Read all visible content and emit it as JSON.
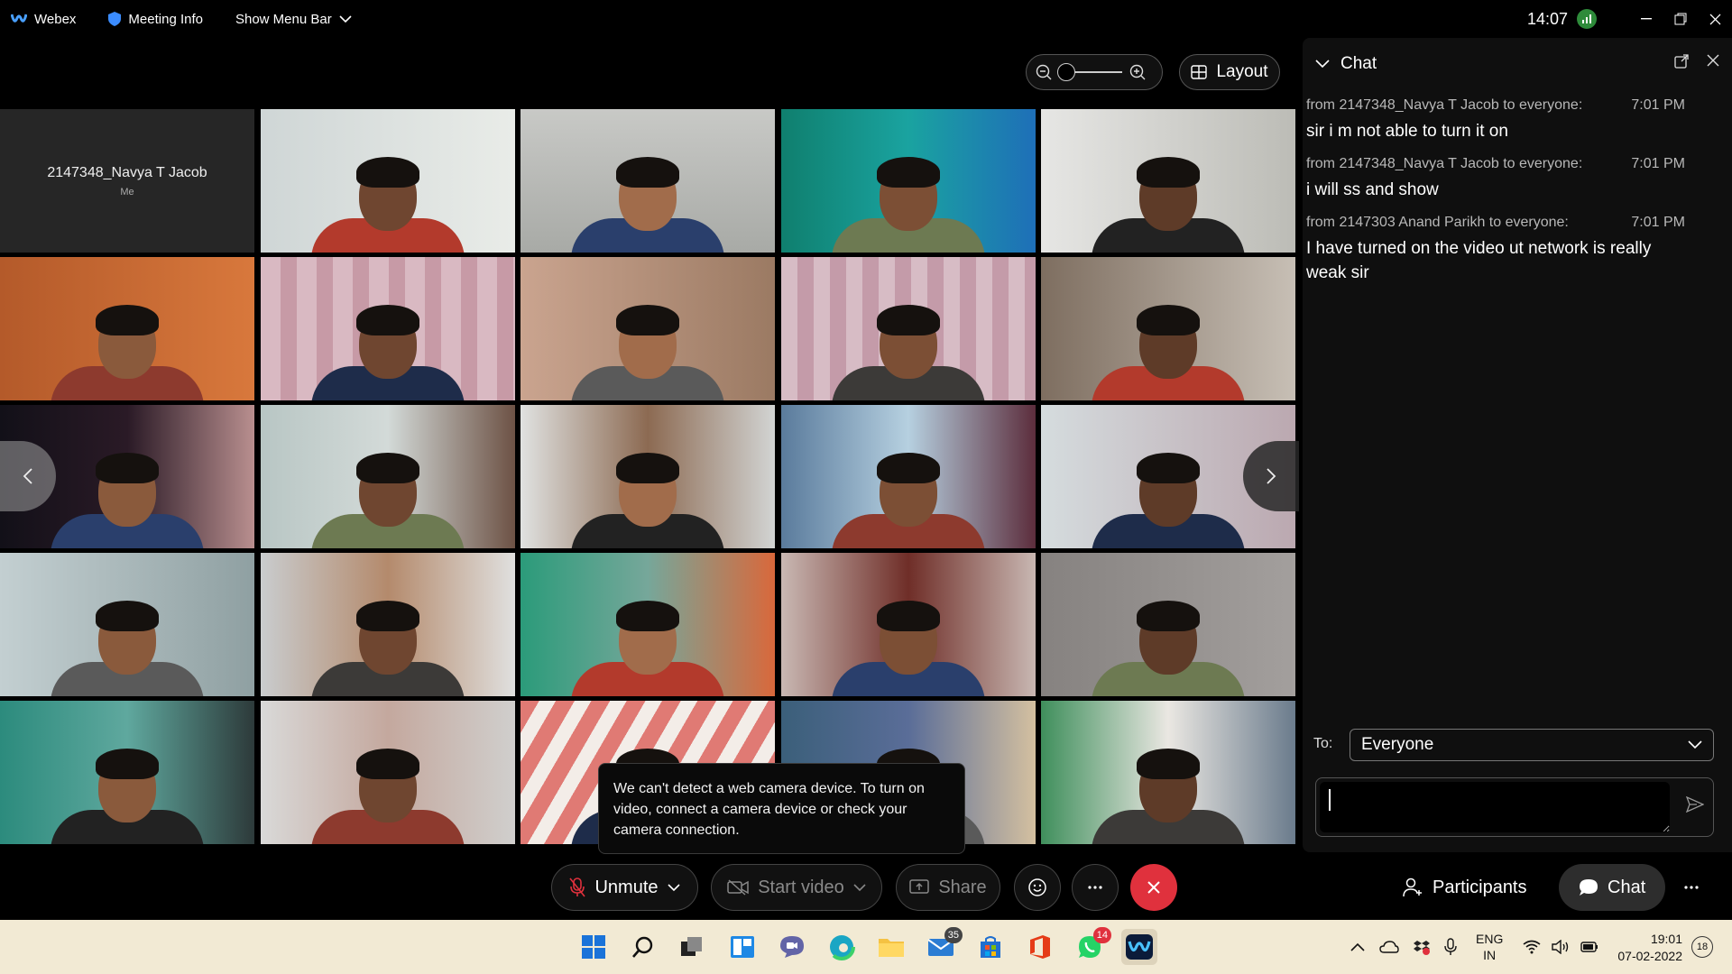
{
  "titlebar": {
    "app_name": "Webex",
    "meeting_info": "Meeting Info",
    "show_menu_bar": "Show Menu Bar",
    "time": "14:07"
  },
  "view": {
    "layout_label": "Layout",
    "zoom_level": 0
  },
  "grid": {
    "self_name": "2147348_Navya T Jacob",
    "self_sub": "Me",
    "participant_count_visible": 25
  },
  "toast": {
    "message": "We can't detect a web camera device. To turn on video, connect a camera device or check your camera connection."
  },
  "chat": {
    "title": "Chat",
    "messages": [
      {
        "from": "from 2147348_Navya T Jacob to everyone:",
        "time": "7:01 PM",
        "text": "sir i m not able to turn it on"
      },
      {
        "from": "from 2147348_Navya T Jacob to everyone:",
        "time": "7:01 PM",
        "text": "i will ss  and show"
      },
      {
        "from": "from 2147303 Anand Parikh to everyone:",
        "time": "7:01 PM",
        "text": "I have turned on the video ut network is really weak sir"
      }
    ],
    "to_label": "To:",
    "to_value": "Everyone",
    "input_value": ""
  },
  "controls": {
    "unmute": "Unmute",
    "start_video": "Start video",
    "share": "Share",
    "participants": "Participants",
    "chat": "Chat"
  },
  "taskbar": {
    "mail_badge": "35",
    "whatsapp_badge": "14",
    "lang_top": "ENG",
    "lang_bottom": "IN",
    "clock_time": "19:01",
    "clock_date": "07-02-2022",
    "notification_count": "18"
  },
  "colors": {
    "end_button": "#e0313d",
    "taskbar_bg": "#f2ead4",
    "panel_bg": "#0f0f0f"
  }
}
